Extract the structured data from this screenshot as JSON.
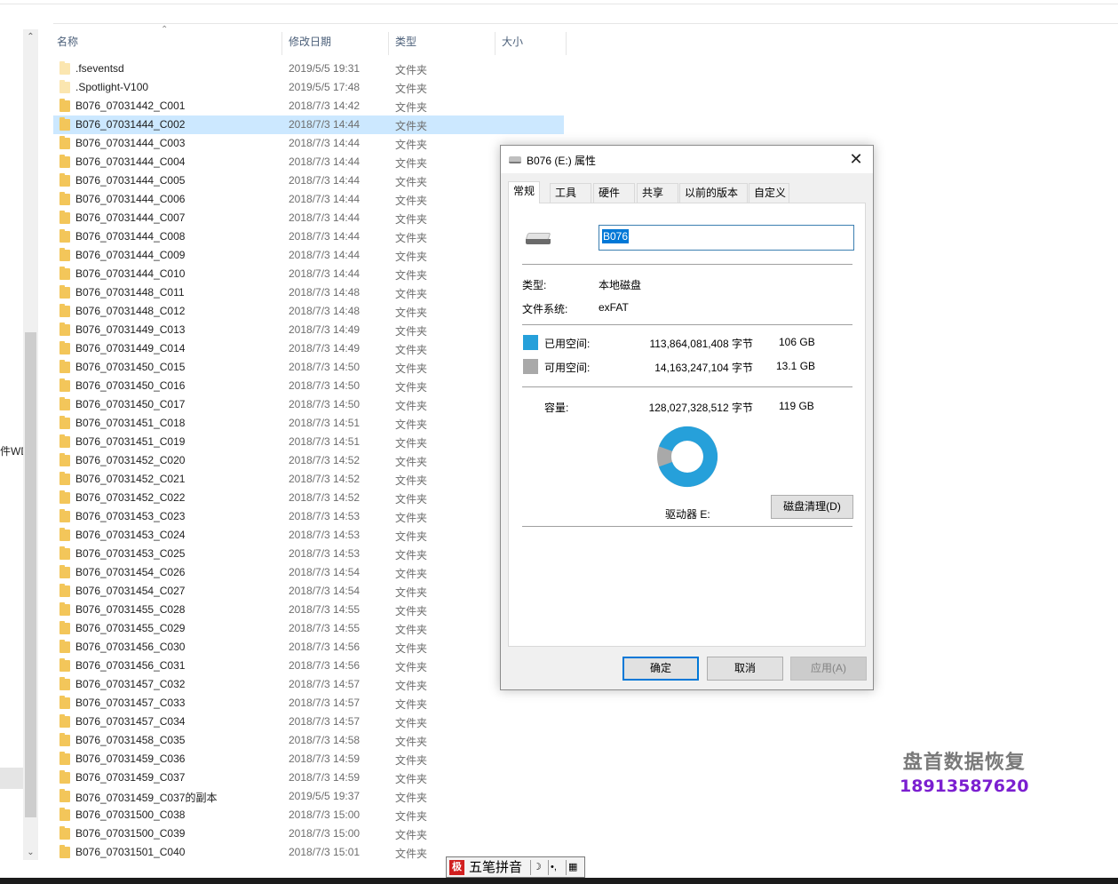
{
  "nav": {
    "truncated_label": "件WD"
  },
  "columns": {
    "name": "名称",
    "date": "修改日期",
    "type": "类型",
    "size": "大小"
  },
  "files": [
    {
      "name": ".fseventsd",
      "date": "2019/5/5 19:31",
      "type": "文件夹"
    },
    {
      "name": ".Spotlight-V100",
      "date": "2019/5/5 17:48",
      "type": "文件夹"
    },
    {
      "name": "B076_07031442_C001",
      "date": "2018/7/3 14:42",
      "type": "文件夹"
    },
    {
      "name": "B076_07031444_C002",
      "date": "2018/7/3 14:44",
      "type": "文件夹"
    },
    {
      "name": "B076_07031444_C003",
      "date": "2018/7/3 14:44",
      "type": "文件夹"
    },
    {
      "name": "B076_07031444_C004",
      "date": "2018/7/3 14:44",
      "type": "文件夹"
    },
    {
      "name": "B076_07031444_C005",
      "date": "2018/7/3 14:44",
      "type": "文件夹"
    },
    {
      "name": "B076_07031444_C006",
      "date": "2018/7/3 14:44",
      "type": "文件夹"
    },
    {
      "name": "B076_07031444_C007",
      "date": "2018/7/3 14:44",
      "type": "文件夹"
    },
    {
      "name": "B076_07031444_C008",
      "date": "2018/7/3 14:44",
      "type": "文件夹"
    },
    {
      "name": "B076_07031444_C009",
      "date": "2018/7/3 14:44",
      "type": "文件夹"
    },
    {
      "name": "B076_07031444_C010",
      "date": "2018/7/3 14:44",
      "type": "文件夹"
    },
    {
      "name": "B076_07031448_C011",
      "date": "2018/7/3 14:48",
      "type": "文件夹"
    },
    {
      "name": "B076_07031448_C012",
      "date": "2018/7/3 14:48",
      "type": "文件夹"
    },
    {
      "name": "B076_07031449_C013",
      "date": "2018/7/3 14:49",
      "type": "文件夹"
    },
    {
      "name": "B076_07031449_C014",
      "date": "2018/7/3 14:49",
      "type": "文件夹"
    },
    {
      "name": "B076_07031450_C015",
      "date": "2018/7/3 14:50",
      "type": "文件夹"
    },
    {
      "name": "B076_07031450_C016",
      "date": "2018/7/3 14:50",
      "type": "文件夹"
    },
    {
      "name": "B076_07031450_C017",
      "date": "2018/7/3 14:50",
      "type": "文件夹"
    },
    {
      "name": "B076_07031451_C018",
      "date": "2018/7/3 14:51",
      "type": "文件夹"
    },
    {
      "name": "B076_07031451_C019",
      "date": "2018/7/3 14:51",
      "type": "文件夹"
    },
    {
      "name": "B076_07031452_C020",
      "date": "2018/7/3 14:52",
      "type": "文件夹"
    },
    {
      "name": "B076_07031452_C021",
      "date": "2018/7/3 14:52",
      "type": "文件夹"
    },
    {
      "name": "B076_07031452_C022",
      "date": "2018/7/3 14:52",
      "type": "文件夹"
    },
    {
      "name": "B076_07031453_C023",
      "date": "2018/7/3 14:53",
      "type": "文件夹"
    },
    {
      "name": "B076_07031453_C024",
      "date": "2018/7/3 14:53",
      "type": "文件夹"
    },
    {
      "name": "B076_07031453_C025",
      "date": "2018/7/3 14:53",
      "type": "文件夹"
    },
    {
      "name": "B076_07031454_C026",
      "date": "2018/7/3 14:54",
      "type": "文件夹"
    },
    {
      "name": "B076_07031454_C027",
      "date": "2018/7/3 14:54",
      "type": "文件夹"
    },
    {
      "name": "B076_07031455_C028",
      "date": "2018/7/3 14:55",
      "type": "文件夹"
    },
    {
      "name": "B076_07031455_C029",
      "date": "2018/7/3 14:55",
      "type": "文件夹"
    },
    {
      "name": "B076_07031456_C030",
      "date": "2018/7/3 14:56",
      "type": "文件夹"
    },
    {
      "name": "B076_07031456_C031",
      "date": "2018/7/3 14:56",
      "type": "文件夹"
    },
    {
      "name": "B076_07031457_C032",
      "date": "2018/7/3 14:57",
      "type": "文件夹"
    },
    {
      "name": "B076_07031457_C033",
      "date": "2018/7/3 14:57",
      "type": "文件夹"
    },
    {
      "name": "B076_07031457_C034",
      "date": "2018/7/3 14:57",
      "type": "文件夹"
    },
    {
      "name": "B076_07031458_C035",
      "date": "2018/7/3 14:58",
      "type": "文件夹"
    },
    {
      "name": "B076_07031459_C036",
      "date": "2018/7/3 14:59",
      "type": "文件夹"
    },
    {
      "name": "B076_07031459_C037",
      "date": "2018/7/3 14:59",
      "type": "文件夹"
    },
    {
      "name": "B076_07031459_C037的副本",
      "date": "2019/5/5 19:37",
      "type": "文件夹"
    },
    {
      "name": "B076_07031500_C038",
      "date": "2018/7/3 15:00",
      "type": "文件夹"
    },
    {
      "name": "B076_07031500_C039",
      "date": "2018/7/3 15:00",
      "type": "文件夹"
    },
    {
      "name": "B076_07031501_C040",
      "date": "2018/7/3 15:01",
      "type": "文件夹"
    }
  ],
  "dialog": {
    "title": "B076 (E:) 属性",
    "tabs": [
      "常规",
      "工具",
      "硬件",
      "共享",
      "以前的版本",
      "自定义"
    ],
    "volume_name": "B076",
    "type_label": "类型:",
    "type_value": "本地磁盘",
    "fs_label": "文件系统:",
    "fs_value": "exFAT",
    "used_label": "已用空间:",
    "used_bytes": "113,864,081,408 字节",
    "used_human": "106 GB",
    "free_label": "可用空间:",
    "free_bytes": "14,163,247,104 字节",
    "free_human": "13.1 GB",
    "capacity_label": "容量:",
    "capacity_bytes": "128,027,328,512 字节",
    "capacity_human": "119 GB",
    "used_fraction": 0.889,
    "drive_label": "驱动器 E:",
    "cleanup_button": "磁盘清理(D)",
    "ok_button": "确定",
    "cancel_button": "取消",
    "apply_button": "应用(A)",
    "colors": {
      "used": "#26a0da",
      "free": "#a9a9a9"
    }
  },
  "watermark": {
    "line1": "盘首数据恢复",
    "line2": "18913587620"
  },
  "ime": {
    "logo": "极",
    "mode": "五笔拼音",
    "moon": "☽",
    "punct": "•,",
    "keyboard": "▦"
  }
}
